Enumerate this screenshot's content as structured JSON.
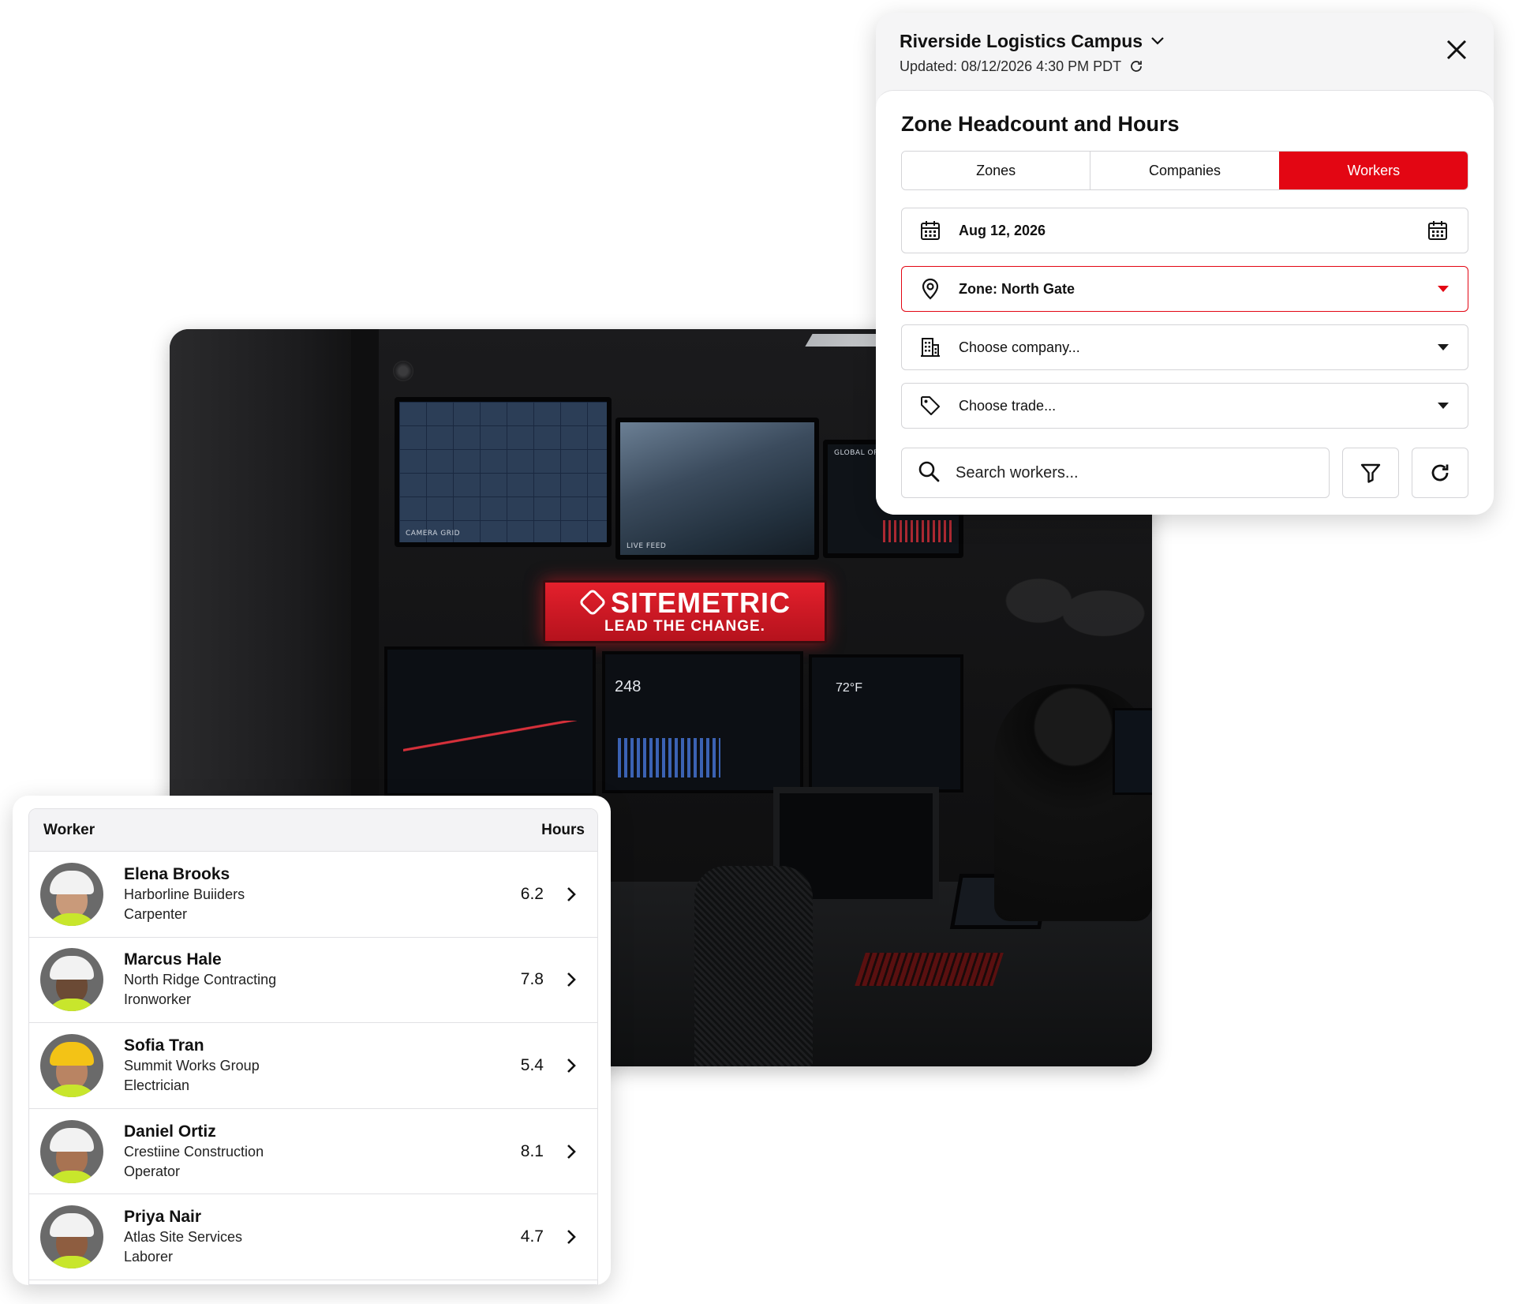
{
  "illustration": {
    "sign_brand": "SITEMETRIC",
    "sign_tagline": "LEAD THE CHANGE.",
    "monitor_labels": [
      "CAMERA GRID",
      "LIVE FEED",
      "GLOBAL OPERATI"
    ],
    "dashboard_value": "248",
    "weather_value": "72°F"
  },
  "panel": {
    "site_name": "Riverside Logistics Campus",
    "updated": "Updated: 08/12/2026 4:30 PM PDT",
    "title": "Zone Headcount and Hours",
    "tabs": [
      {
        "label": "Zones",
        "active": false
      },
      {
        "label": "Companies",
        "active": false
      },
      {
        "label": "Workers",
        "active": true
      }
    ],
    "date_value": "Aug 12, 2026",
    "zone_value": "Zone: North Gate",
    "company_placeholder": "Choose company...",
    "trade_placeholder": "Choose trade...",
    "search_placeholder": "Search workers..."
  },
  "workers_table": {
    "col_worker": "Worker",
    "col_hours": "Hours",
    "rows": [
      {
        "name": "Elena Brooks",
        "company": "Harborline Buiiders",
        "trade": "Carpenter",
        "hours": "6.2",
        "helmet": "#f2f2f2",
        "skin": "#c99a7a"
      },
      {
        "name": "Marcus Hale",
        "company": "North Ridge Contracting",
        "trade": "Ironworker",
        "hours": "7.8",
        "helmet": "#f2f2f2",
        "skin": "#6b4a35"
      },
      {
        "name": "Sofia Tran",
        "company": "Summit Works Group",
        "trade": "Electrician",
        "hours": "5.4",
        "helmet": "#f3c316",
        "skin": "#b98463"
      },
      {
        "name": "Daniel Ortiz",
        "company": "Crestiine Construction",
        "trade": "Operator",
        "hours": "8.1",
        "helmet": "#f2f2f2",
        "skin": "#a87352"
      },
      {
        "name": "Priya Nair",
        "company": "Atlas Site Services",
        "trade": "Laborer",
        "hours": "4.7",
        "helmet": "#f2f2f2",
        "skin": "#8e5d40"
      }
    ]
  },
  "colors": {
    "accent": "#e30613",
    "vest": "#c8e62c"
  }
}
